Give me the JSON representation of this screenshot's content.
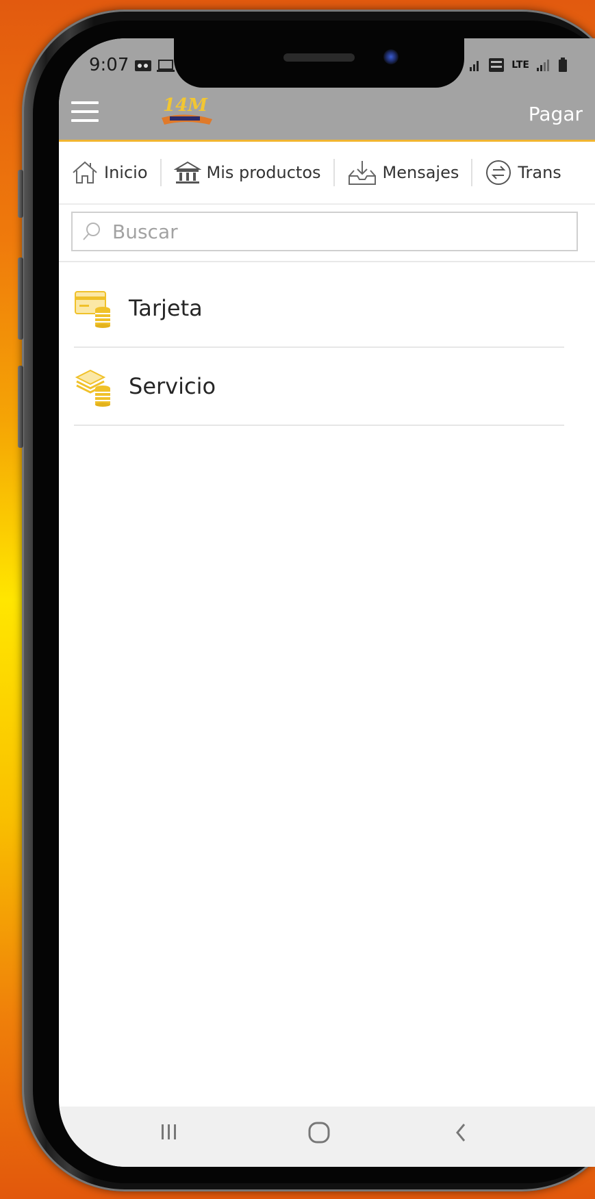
{
  "status_bar": {
    "time": "9:07",
    "network_label": "LTE"
  },
  "header": {
    "pay_link": "Pagar",
    "logo_alt": "14 de marzo"
  },
  "tabs": [
    {
      "label": "Inicio",
      "icon": "home-icon"
    },
    {
      "label": "Mis productos",
      "icon": "bank-icon"
    },
    {
      "label": "Mensajes",
      "icon": "inbox-icon"
    },
    {
      "label": "Trans",
      "icon": "transfer-icon"
    }
  ],
  "search": {
    "placeholder": "Buscar",
    "value": ""
  },
  "list": [
    {
      "label": "Tarjeta",
      "icon": "card-coins-icon"
    },
    {
      "label": "Servicio",
      "icon": "stack-coins-icon"
    }
  ],
  "colors": {
    "appbar": "#a3a3a3",
    "accent": "#f1b530",
    "icon_gold": "#f0c12a"
  }
}
